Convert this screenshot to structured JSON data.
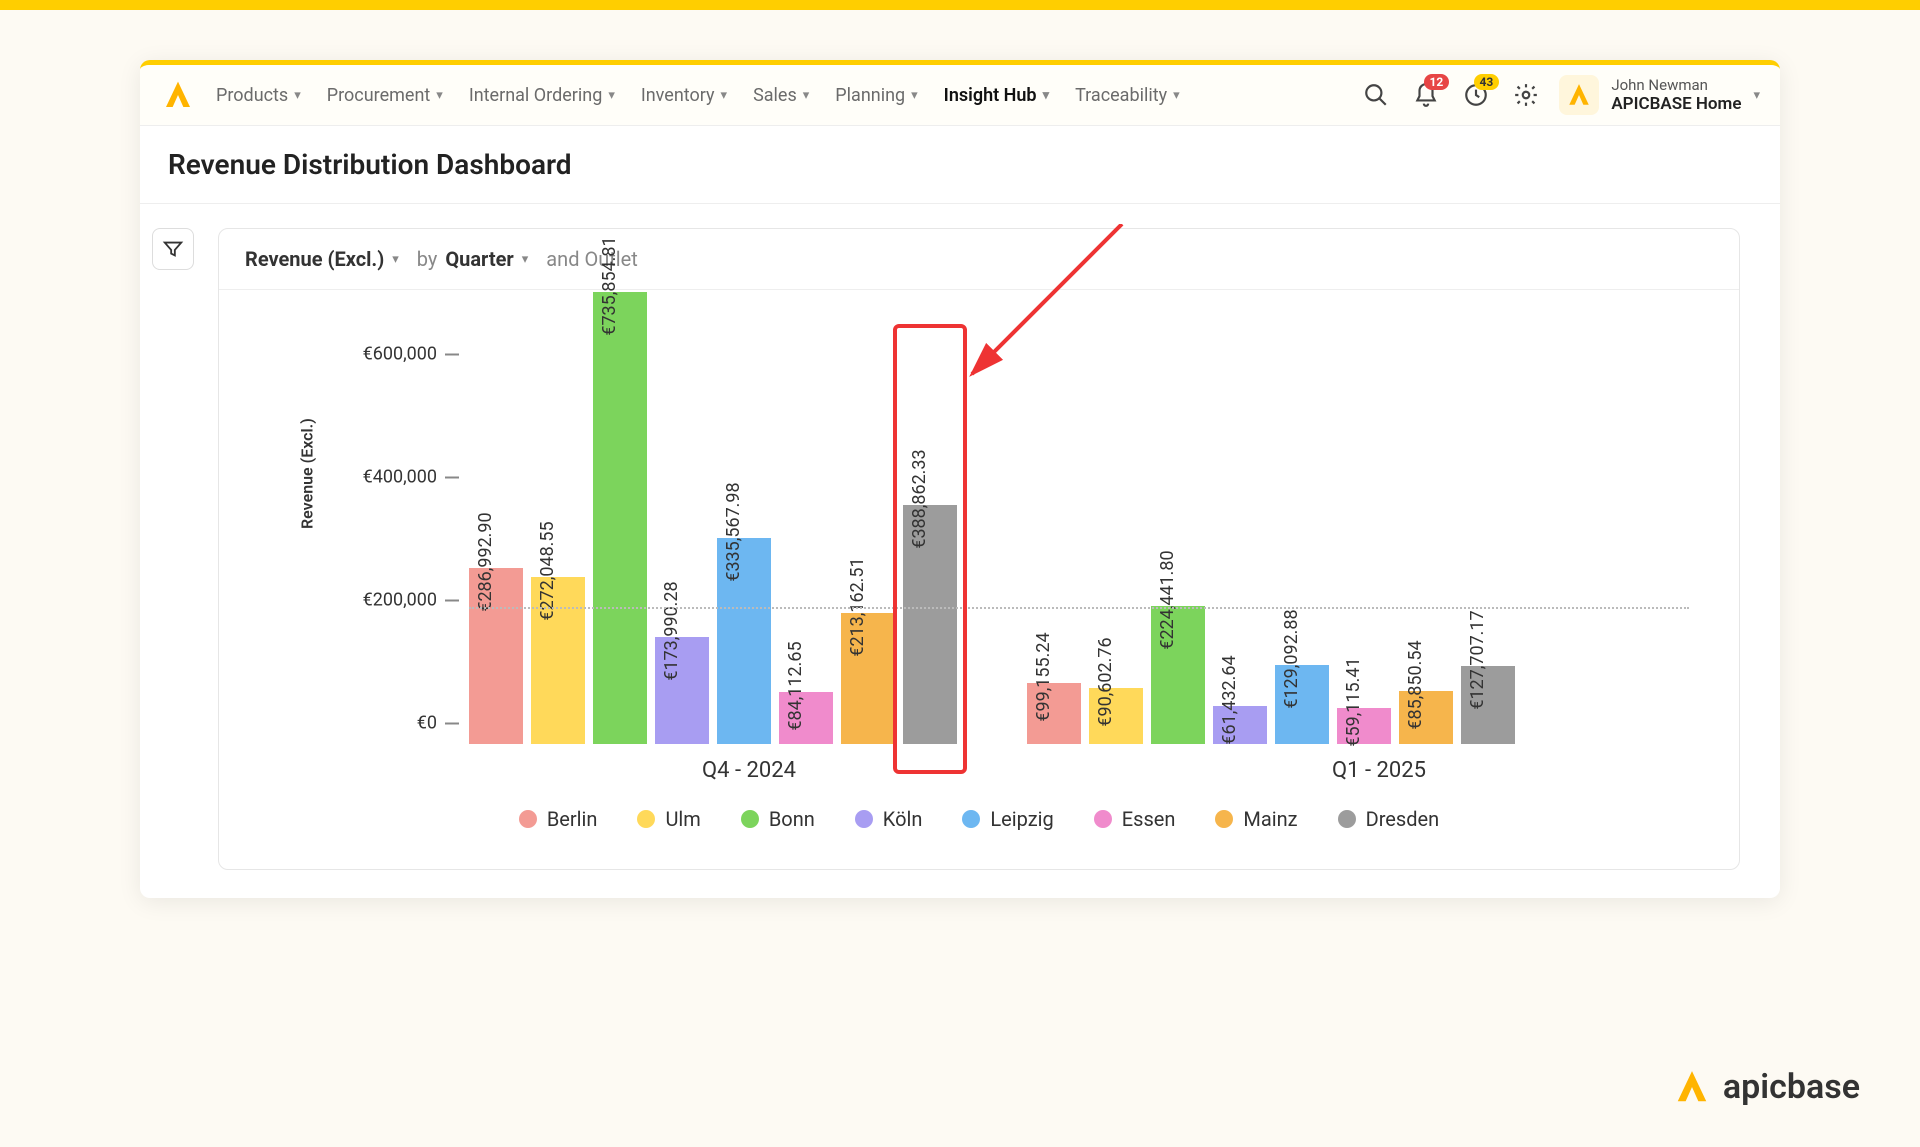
{
  "brand": "apicbase",
  "header": {
    "nav": [
      {
        "label": "Products"
      },
      {
        "label": "Procurement"
      },
      {
        "label": "Internal Ordering"
      },
      {
        "label": "Inventory"
      },
      {
        "label": "Sales"
      },
      {
        "label": "Planning"
      },
      {
        "label": "Insight Hub",
        "active": true
      },
      {
        "label": "Traceability"
      }
    ],
    "notifications_badge": "12",
    "inbox_badge": "43",
    "user_name": "John Newman",
    "user_org": "APICBASE Home"
  },
  "page_title": "Revenue Distribution Dashboard",
  "controls": {
    "metric": "Revenue (Excl.)",
    "by_label": "by",
    "by_value": "Quarter",
    "and_label": "and Outlet"
  },
  "colors": {
    "Berlin": "#f39b94",
    "Ulm": "#ffd95a",
    "Bonn": "#7cd45c",
    "Köln": "#a89df2",
    "Leipzig": "#6db7f1",
    "Essen": "#f08bcc",
    "Mainz": "#f6b54c",
    "Dresden": "#9c9c9c"
  },
  "chart_data": {
    "type": "bar",
    "ylabel": "Revenue (Excl.)",
    "ylim": [
      0,
      700000
    ],
    "yticks": [
      0,
      200000,
      400000,
      600000
    ],
    "ytick_labels": [
      "€0",
      "€200,000",
      "€400,000",
      "€600,000"
    ],
    "avg_line_value": 220000,
    "categories": [
      "Q4 - 2024",
      "Q1 - 2025"
    ],
    "series": [
      {
        "name": "Berlin",
        "values": [
          286992.9,
          99155.24
        ],
        "labels": [
          "€286,992.90",
          "€99,155.24"
        ]
      },
      {
        "name": "Ulm",
        "values": [
          272048.55,
          90602.76
        ],
        "labels": [
          "€272,048.55",
          "€90,602.76"
        ]
      },
      {
        "name": "Bonn",
        "values": [
          735854.81,
          224441.8
        ],
        "labels": [
          "€735,854.81",
          "€224,441.80"
        ]
      },
      {
        "name": "Köln",
        "values": [
          173990.28,
          61432.64
        ],
        "labels": [
          "€173,990.28",
          "€61,432.64"
        ]
      },
      {
        "name": "Leipzig",
        "values": [
          335567.98,
          129092.88
        ],
        "labels": [
          "€335,567.98",
          "€129,092.88"
        ]
      },
      {
        "name": "Essen",
        "values": [
          84112.65,
          59115.41
        ],
        "labels": [
          "€84,112.65",
          "€59,115.41"
        ]
      },
      {
        "name": "Mainz",
        "values": [
          213162.51,
          85850.54
        ],
        "labels": [
          "€213,162.51",
          "€85,850.54"
        ]
      },
      {
        "name": "Dresden",
        "values": [
          388862.33,
          127707.17
        ],
        "labels": [
          "€388,862.33",
          "€127,707.17"
        ]
      }
    ],
    "highlighted": {
      "category_index": 0,
      "series_index": 7
    }
  }
}
